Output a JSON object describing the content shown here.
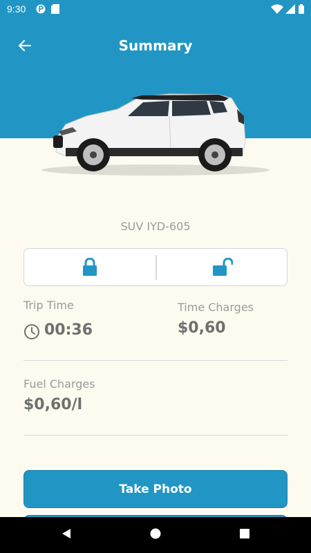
{
  "status_bar": {
    "time": "9:30"
  },
  "header": {
    "title": "Summary"
  },
  "vehicle": {
    "name": "SUV IYD-605"
  },
  "trip": {
    "trip_time_label": "Trip Time",
    "trip_time_value": "00:36",
    "time_charges_label": "Time Charges",
    "time_charges_value": "$0,60",
    "fuel_charges_label": "Fuel Charges",
    "fuel_charges_value": "$0,60/l"
  },
  "actions": {
    "take_photo_label": "Take Photo"
  },
  "colors": {
    "accent": "#2196c4",
    "background": "#fdfbf0"
  },
  "icons": [
    "arrow-left-icon",
    "lock-icon",
    "unlock-icon",
    "clock-icon"
  ]
}
